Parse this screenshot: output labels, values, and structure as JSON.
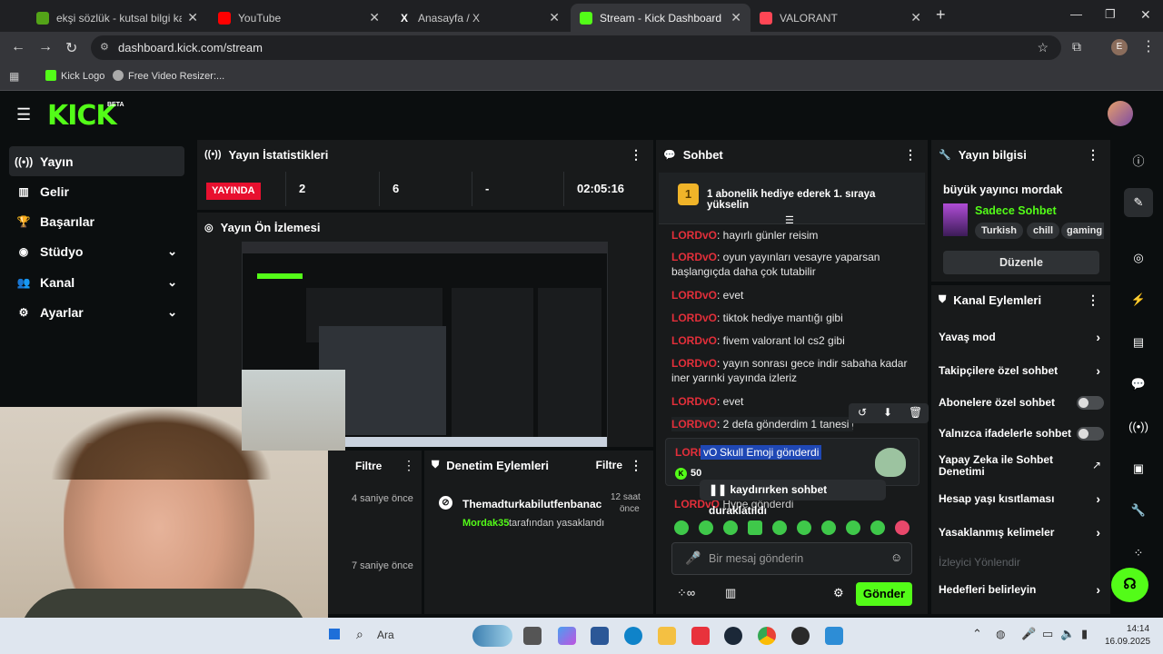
{
  "browser": {
    "tabs": [
      {
        "title": "ekşi sözlük - kutsal bilgi kaynağı",
        "color": "#53a318"
      },
      {
        "title": "YouTube",
        "color": "#ff0000"
      },
      {
        "title": "Anasayfa / X",
        "color": "#ffffff"
      },
      {
        "title": "Stream - Kick Dashboard",
        "color": "#53fc18",
        "active": true
      },
      {
        "title": "VALORANT",
        "color": "#ff4655"
      }
    ],
    "url": "dashboard.kick.com/stream",
    "profile_initial": "E",
    "bookmarks": [
      "Kick Logo",
      "Free Video Resizer:..."
    ]
  },
  "kick": {
    "logo": "KICK",
    "beta": "BETA",
    "brand_color": "#53fc18",
    "sidebar": [
      {
        "label": "Yayın",
        "icon": "broadcast-icon",
        "active": true
      },
      {
        "label": "Gelir",
        "icon": "chart-icon"
      },
      {
        "label": "Başarılar",
        "icon": "trophy-icon"
      },
      {
        "label": "Stüdyo",
        "icon": "camera-icon",
        "expandable": true
      },
      {
        "label": "Kanal",
        "icon": "users-icon",
        "expandable": true
      },
      {
        "label": "Ayarlar",
        "icon": "gear-icon",
        "expandable": true
      }
    ],
    "stats": {
      "title": "Yayın İstatistikleri",
      "live_badge": "YAYINDA",
      "viewers": "2",
      "followers": "6",
      "subs": "-",
      "duration": "02:05:16"
    },
    "preview": {
      "title": "Yayın Ön İzlemesi"
    },
    "activity": {
      "filter": "Filtre",
      "times": [
        "4 saniye önce",
        "7 saniye önce"
      ]
    },
    "moderation": {
      "title": "Denetim Eylemleri",
      "filter": "Filtre",
      "entry_user": "Themadturkabilutfenbanac",
      "entry_time_1": "12 saat",
      "entry_time_2": "önce",
      "entry_by": "Mordak35",
      "entry_suffix": "tarafından yasaklandı"
    },
    "chat": {
      "title": "Sohbet",
      "goal_badge": "1",
      "goal_text": "1 abonelik hediye ederek 1. sıraya yükselin",
      "messages": [
        {
          "user": "LORDvO",
          "text": ": hayırlı günler reisim"
        },
        {
          "user": "LORDvO",
          "text": ": oyun yayınları vesayre yaparsan başlangıçda daha çok tutabilir"
        },
        {
          "user": "LORDvO",
          "text": ": evet"
        },
        {
          "user": "LORDvO",
          "text": ": tiktok hediye mantığı gibi"
        },
        {
          "user": "LORDvO",
          "text": ": fivem valorant lol cs2 gibi"
        },
        {
          "user": "LORDvO",
          "text": ": yayın sonrası gece indir sabaha kadar iner yarınki yayında izleriz"
        },
        {
          "user": "LORDvO",
          "text": ": evet"
        },
        {
          "user": "LORDvO",
          "text": ": 2 defa gönderdim 1 tanesi gözükmedi"
        }
      ],
      "gift": {
        "user_a": "LORD",
        "user_b": "vO",
        "text": "Skull Emoji gönderdi",
        "amount": "50"
      },
      "gift2": {
        "user": "LORDvO",
        "text": "Hype gönderdi"
      },
      "paused": "kaydırırken sohbet duraklatıldı",
      "input_placeholder": "Bir mesaj gönderin",
      "send": "Gönder"
    },
    "stream_info": {
      "title": "Yayın bilgisi",
      "stream_title": "büyük yayıncı mordak",
      "category": "Sadece Sohbet",
      "tags": [
        "Turkish",
        "chill",
        "gaming"
      ],
      "edit": "Düzenle"
    },
    "channel_actions": {
      "title": "Kanal Eylemleri",
      "items": [
        {
          "label": "Yavaş mod",
          "type": "arrow"
        },
        {
          "label": "Takipçilere özel sohbet",
          "type": "arrow"
        },
        {
          "label": "Abonelere özel sohbet",
          "type": "toggle"
        },
        {
          "label": "Yalnızca ifadelerle sohbet",
          "type": "toggle"
        },
        {
          "label": "Yapay Zeka ile Sohbet Denetimi",
          "type": "external"
        },
        {
          "label": "Hesap yaşı kısıtlaması",
          "type": "arrow"
        },
        {
          "label": "Yasaklanmış kelimeler",
          "type": "arrow"
        }
      ],
      "viewer_section": "İzleyici Yönlendir",
      "goals": "Hedefleri belirleyin"
    }
  },
  "taskbar": {
    "search": "Ara",
    "time": "14:14",
    "date": "16.09.2025"
  }
}
